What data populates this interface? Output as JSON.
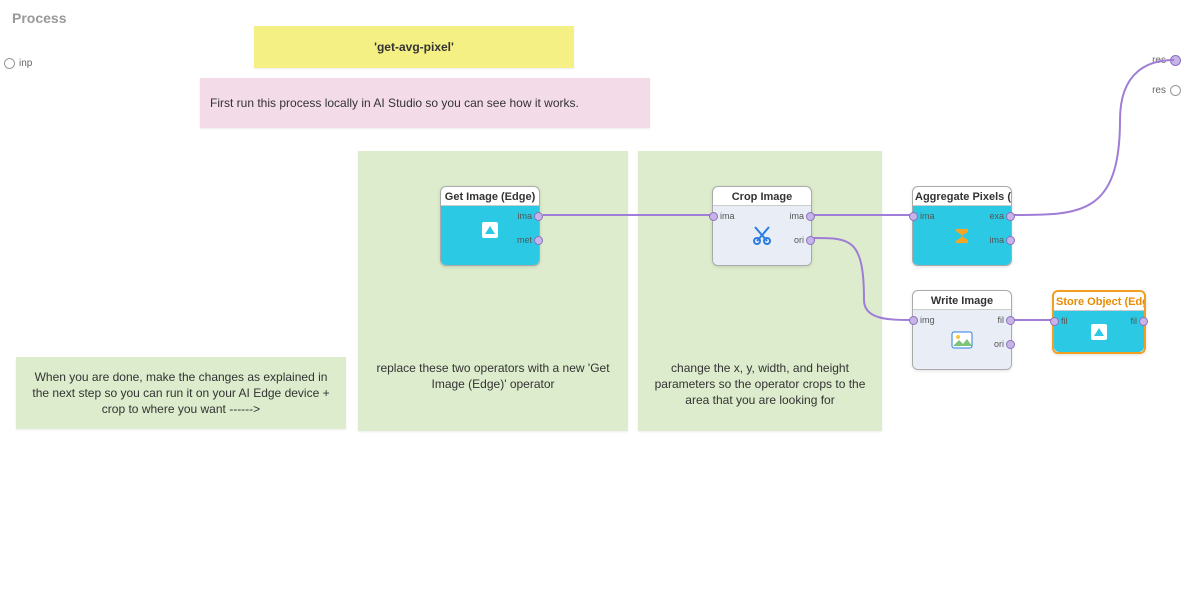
{
  "title": "Process",
  "proc_ports": {
    "inp": "inp",
    "res1": "res",
    "res2": "res"
  },
  "notes": {
    "yellow": "'get-avg-pixel'",
    "pink": "First run this process locally in AI Studio so you can see how it works.",
    "green_left": "When you are done, make the changes as explained in the next step so you can run it on your AI Edge device + crop to where you want ------>",
    "green_mid": "replace these two operators with a new 'Get Image (Edge)' operator",
    "green_right": "change the x, y, width, and height parameters so the operator crops to the area that you are looking for"
  },
  "ops": {
    "get_image": {
      "title": "Get Image (Edge)",
      "ports": {
        "ima": "ima",
        "met": "met"
      }
    },
    "crop": {
      "title": "Crop Image",
      "ports": {
        "in_ima": "ima",
        "out_ima": "ima",
        "ori": "ori"
      }
    },
    "agg": {
      "title": "Aggregate Pixels (B...",
      "ports": {
        "in_ima": "ima",
        "exa": "exa",
        "out_ima": "ima"
      }
    },
    "write": {
      "title": "Write Image",
      "ports": {
        "img": "img",
        "fil": "fil",
        "ori": "ori"
      }
    },
    "store": {
      "title": "Store Object (Edge)",
      "ports": {
        "in_fil": "fil",
        "out_fil": "fil"
      }
    }
  }
}
